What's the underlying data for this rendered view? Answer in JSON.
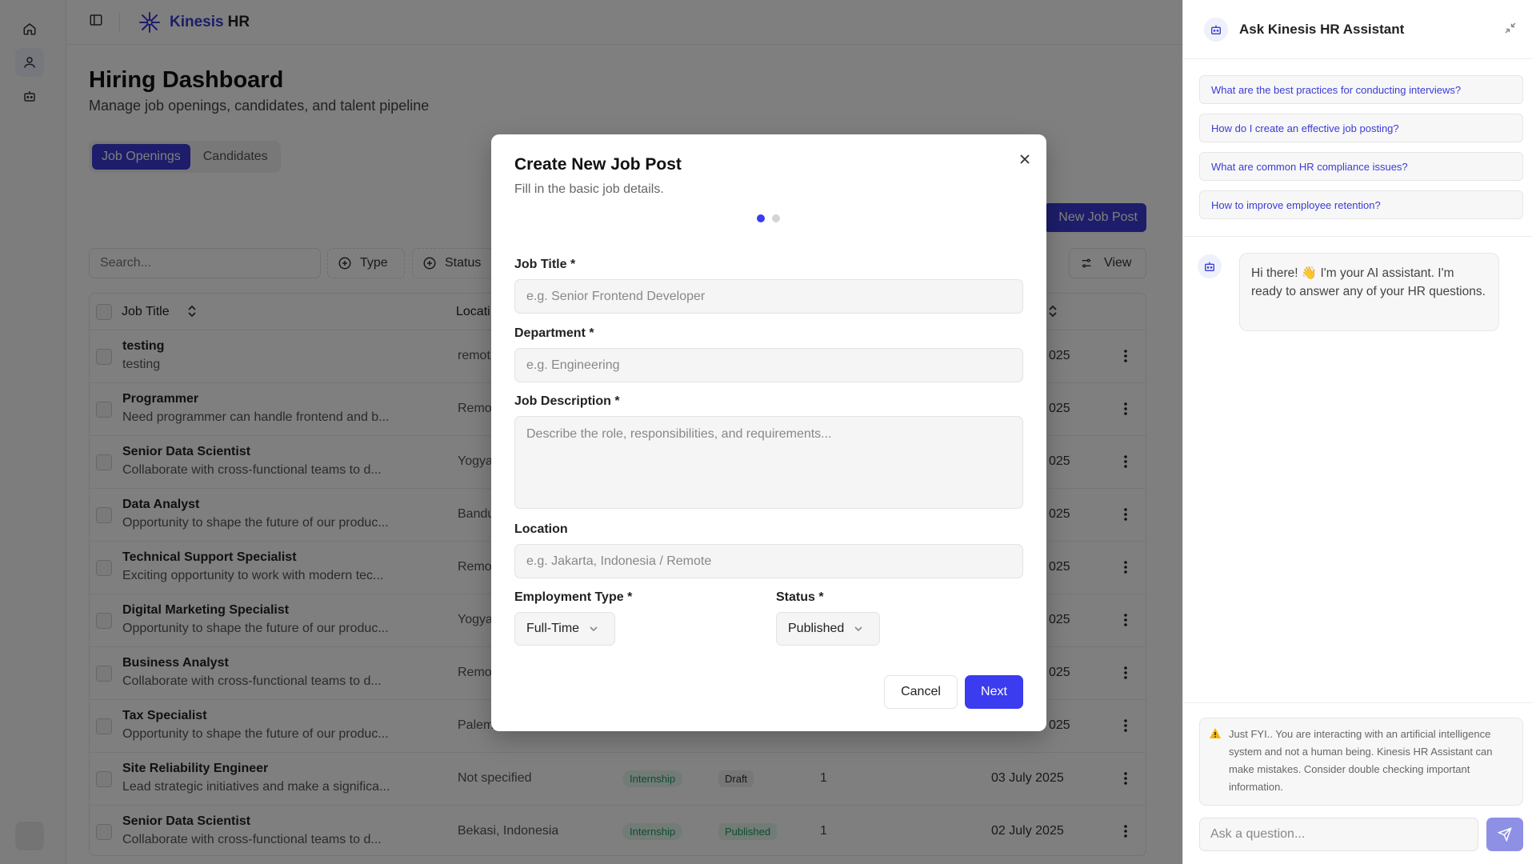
{
  "app": {
    "brand_name": "Kinesis",
    "brand_suffix": "HR"
  },
  "page": {
    "title": "Hiring Dashboard",
    "subtitle": "Manage job openings, candidates, and talent pipeline"
  },
  "tabs": [
    {
      "label": "Job Openings",
      "active": true
    },
    {
      "label": "Candidates",
      "active": false
    }
  ],
  "toolbar": {
    "new_job_label": "New Job Post",
    "search_placeholder": "Search...",
    "filter_type": "Type",
    "filter_status": "Status",
    "view_label": "View"
  },
  "table": {
    "headers": {
      "job_title": "Job Title",
      "location": "Locati"
    },
    "rows": [
      {
        "title": "testing",
        "desc": "testing",
        "location": "remot",
        "date": "025"
      },
      {
        "title": "Programmer",
        "desc": "Need programmer can handle frontend and b...",
        "location": "Remo",
        "date": "025"
      },
      {
        "title": "Senior Data Scientist",
        "desc": "Collaborate with cross-functional teams to d...",
        "location": "Yogya",
        "date": "025"
      },
      {
        "title": "Data Analyst",
        "desc": "Opportunity to shape the future of our produc...",
        "location": "Bandu",
        "date": "025"
      },
      {
        "title": "Technical Support Specialist",
        "desc": "Exciting opportunity to work with modern tec...",
        "location": "Remo",
        "date": "025"
      },
      {
        "title": "Digital Marketing Specialist",
        "desc": "Opportunity to shape the future of our produc...",
        "location": "Yogya",
        "date": "025"
      },
      {
        "title": "Business Analyst",
        "desc": "Collaborate with cross-functional teams to d...",
        "location": "Remo",
        "date": "025"
      },
      {
        "title": "Tax Specialist",
        "desc": "Opportunity to shape the future of our produc...",
        "location": "Palem",
        "date": "025"
      },
      {
        "title": "Site Reliability Engineer",
        "desc": "Lead strategic initiatives and make a significa...",
        "location": "Not specified",
        "type": "Internship",
        "status": "Draft",
        "count": "1",
        "date": "03 July 2025"
      },
      {
        "title": "Senior Data Scientist",
        "desc": "Collaborate with cross-functional teams to d...",
        "location": "Bekasi, Indonesia",
        "type": "Internship",
        "status": "Published",
        "count": "1",
        "date": "02 July 2025"
      }
    ]
  },
  "assistant": {
    "title": "Ask Kinesis HR Assistant",
    "suggestions": [
      "What are the best practices for conducting interviews?",
      "How do I create an effective job posting?",
      "What are common HR compliance issues?",
      "How to improve employee retention?"
    ],
    "greeting": "Hi there! 👋 I'm your AI assistant. I'm ready to answer any of your HR questions.",
    "disclaimer": "Just FYI.. You are interacting with an artificial intelligence system and not a human being. Kinesis HR Assistant can make mistakes. Consider double checking important information.",
    "input_placeholder": "Ask a question..."
  },
  "modal": {
    "title": "Create New Job Post",
    "description": "Fill in the basic job details.",
    "job_title_label": "Job Title *",
    "job_title_placeholder": "e.g. Senior Frontend Developer",
    "department_label": "Department *",
    "department_placeholder": "e.g. Engineering",
    "description_label": "Job Description *",
    "description_placeholder": "Describe the role, responsibilities, and requirements...",
    "location_label": "Location",
    "location_placeholder": "e.g. Jakarta, Indonesia / Remote",
    "employment_type_label": "Employment Type *",
    "employment_type_value": "Full-Time",
    "status_label": "Status *",
    "status_value": "Published",
    "cancel_label": "Cancel",
    "next_label": "Next"
  },
  "colors": {
    "accent": "#3b3bd6",
    "button_primary": "#3b3bf0",
    "badge_green": "#1b9b66"
  }
}
